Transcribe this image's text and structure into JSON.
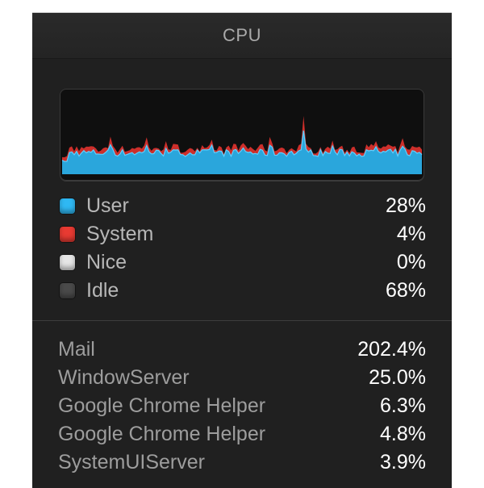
{
  "window": {
    "title": "CPU"
  },
  "legend": [
    {
      "label": "User",
      "value": "28%",
      "color": "#2fb8f3"
    },
    {
      "label": "System",
      "value": "4%",
      "color": "#e83a32"
    },
    {
      "label": "Nice",
      "value": "0%",
      "color": "#e6e6e6"
    },
    {
      "label": "Idle",
      "value": "68%",
      "color": "#4a4a4a"
    }
  ],
  "processes": [
    {
      "name": "Mail",
      "value": "202.4%"
    },
    {
      "name": "WindowServer",
      "value": "25.0%"
    },
    {
      "name": "Google Chrome Helper",
      "value": "6.3%"
    },
    {
      "name": "Google Chrome Helper",
      "value": "4.8%"
    },
    {
      "name": "SystemUIServer",
      "value": "3.9%"
    }
  ]
}
